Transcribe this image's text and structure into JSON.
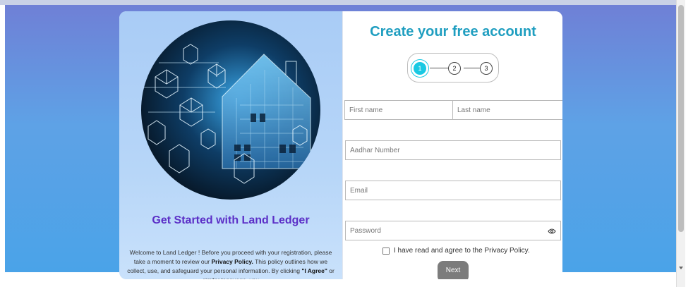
{
  "page": {
    "left": {
      "title": "Get Started with Land Ledger",
      "intro": {
        "t1": "Welcome to Land Ledger ! Before you proceed with your registration, please take a moment to review our ",
        "b1": "Privacy Policy.",
        "t2": " This policy outlines how we collect, use, and safeguard your personal information. By clicking ",
        "b2": "\"I Agree\"",
        "t3": " or similar language, you"
      }
    },
    "right": {
      "title": "Create your free account",
      "steps": [
        "1",
        "2",
        "3"
      ],
      "fields": {
        "first_name_placeholder": "First name",
        "last_name_placeholder": "Last name",
        "aadhar_placeholder": "Aadhar Number",
        "email_placeholder": "Email",
        "password_placeholder": "Password"
      },
      "agree_label": "I have read and agree to the Privacy Policy.",
      "next_label": "Next"
    }
  },
  "colors": {
    "title_teal": "#1f9ec0",
    "left_title_purple": "#5b2fc7",
    "active_step": "#19c9e3",
    "next_button": "#7c7c7c"
  },
  "icons": {
    "password_toggle": "eye-icon"
  }
}
